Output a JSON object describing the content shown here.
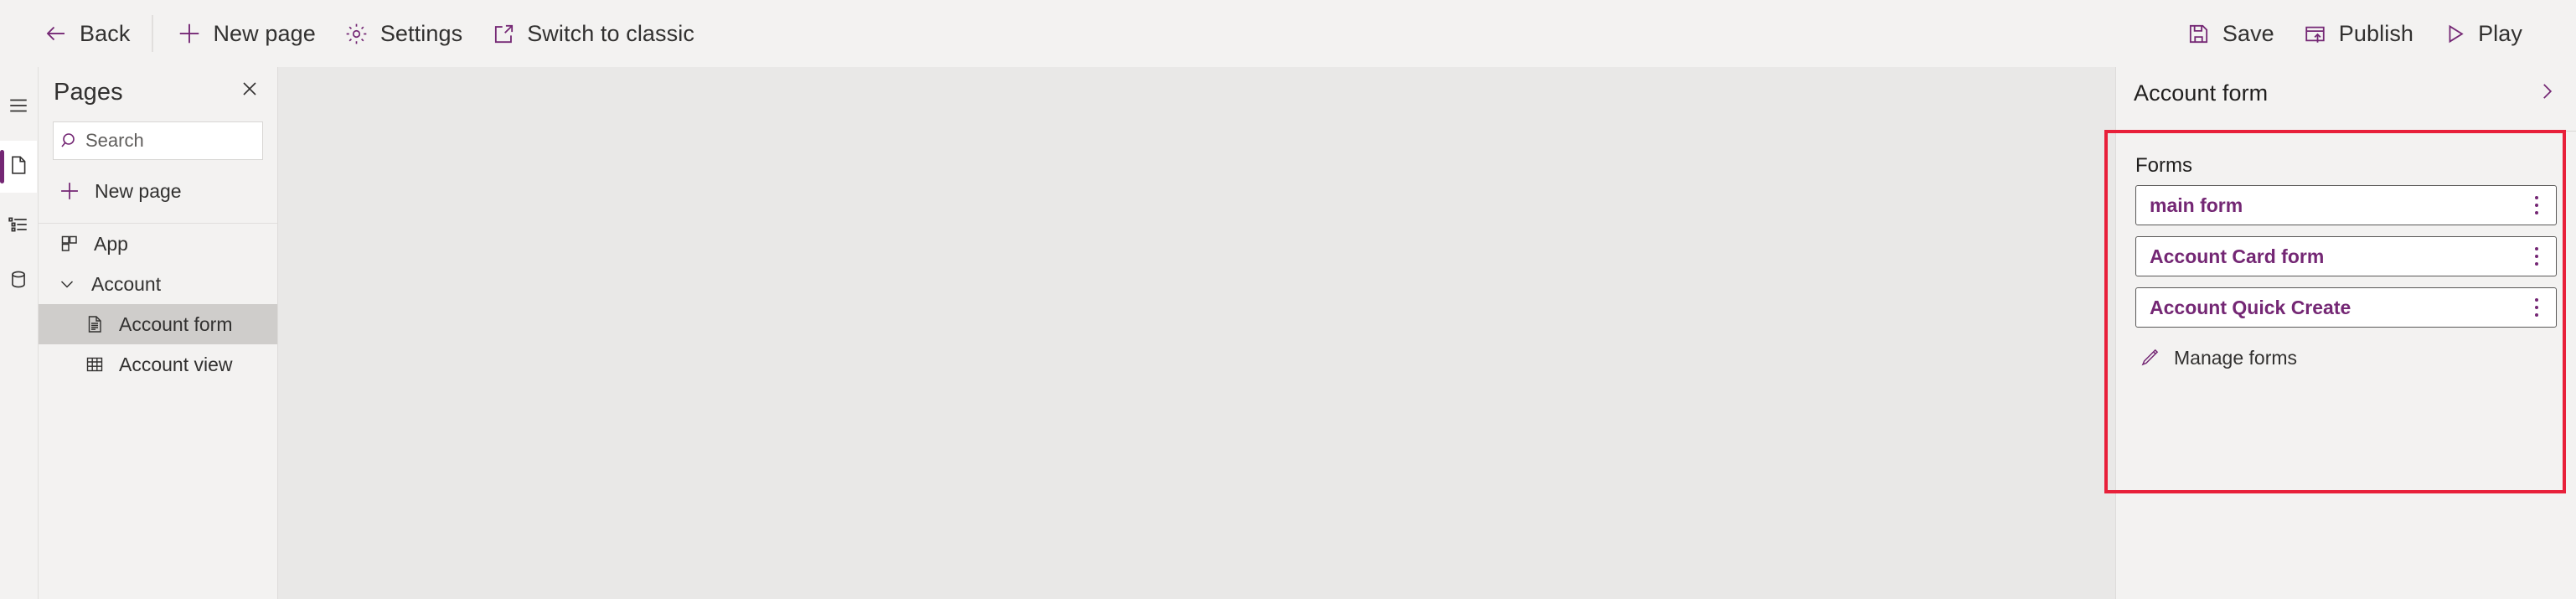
{
  "commandbar": {
    "left_buttons": [
      {
        "label": "Back",
        "icon": "arrow-left-icon"
      },
      {
        "label": "New page",
        "icon": "plus-icon"
      },
      {
        "label": "Settings",
        "icon": "gear-icon"
      },
      {
        "label": "Switch to classic",
        "icon": "open-in-new-window-icon"
      }
    ],
    "right_buttons": [
      {
        "label": "Save",
        "icon": "save-icon"
      },
      {
        "label": "Publish",
        "icon": "publish-icon"
      },
      {
        "label": "Play",
        "icon": "play-icon"
      }
    ]
  },
  "rail": {
    "items": [
      {
        "name": "hamburger-menu",
        "icon": "hamburger-icon",
        "selected": false
      },
      {
        "name": "pages",
        "icon": "page-icon",
        "selected": true
      },
      {
        "name": "navigation",
        "icon": "list-tree-icon",
        "selected": false
      },
      {
        "name": "data",
        "icon": "database-icon",
        "selected": false
      }
    ]
  },
  "pages_panel": {
    "title": "Pages",
    "close_icon": "close-icon",
    "search": {
      "placeholder": "Search",
      "value": "",
      "icon": "search-icon"
    },
    "new_page": {
      "label": "New page",
      "icon": "plus-icon"
    },
    "tree": [
      {
        "label": "App",
        "icon": "app-grid-icon",
        "level": 0,
        "selected": false,
        "expandable": false
      },
      {
        "label": "Account",
        "icon": "chevron-down-icon",
        "level": 1,
        "selected": false,
        "expandable": true
      },
      {
        "label": "Account form",
        "icon": "form-document-icon",
        "level": 2,
        "selected": true,
        "expandable": false
      },
      {
        "label": "Account view",
        "icon": "table-grid-icon",
        "level": 2,
        "selected": false,
        "expandable": false
      }
    ]
  },
  "properties_panel": {
    "title": "Account form",
    "expand_icon": "chevron-right-icon",
    "section_label": "Forms",
    "forms": [
      {
        "name": "main form",
        "menu_icon": "kebab-menu-icon"
      },
      {
        "name": "Account Card form",
        "menu_icon": "kebab-menu-icon"
      },
      {
        "name": "Account Quick Create",
        "menu_icon": "kebab-menu-icon"
      }
    ],
    "manage_forms": {
      "label": "Manage forms",
      "icon": "pencil-edit-icon"
    }
  },
  "annotation": {
    "color": "#e8203a",
    "shape": "rectangle"
  },
  "colors": {
    "accent_purple": "#742774",
    "chrome_background": "#f3f2f1",
    "canvas_background": "#e9e8e7",
    "text_primary": "#323130",
    "selected_row": "#cfcdcb",
    "annotation_red": "#e8203a"
  }
}
